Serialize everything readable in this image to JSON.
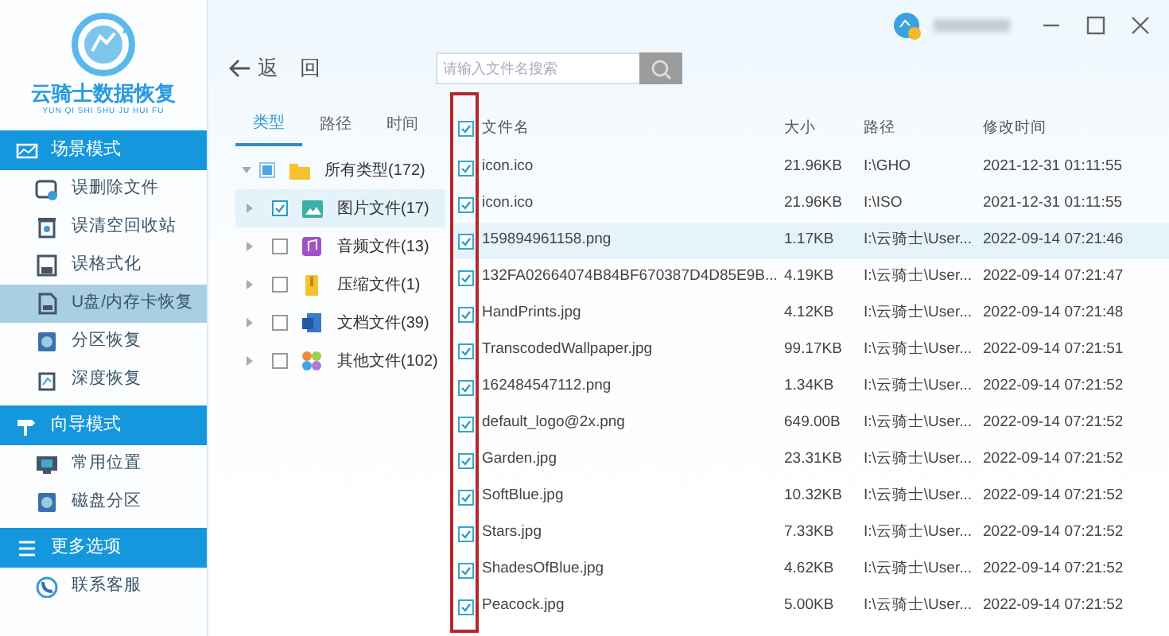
{
  "app": {
    "title": "云骑士数据恢复",
    "subtitle": "YUN QI SHI SHU JU HUI FU"
  },
  "sidebar": {
    "sections": [
      {
        "label": "场景模式",
        "items": [
          {
            "label": "误删除文件",
            "selected": false
          },
          {
            "label": "误清空回收站",
            "selected": false
          },
          {
            "label": "误格式化",
            "selected": false
          },
          {
            "label": "U盘/内存卡恢复",
            "selected": true
          },
          {
            "label": "分区恢复",
            "selected": false
          },
          {
            "label": "深度恢复",
            "selected": false
          }
        ]
      },
      {
        "label": "向导模式",
        "items": [
          {
            "label": "常用位置",
            "selected": false
          },
          {
            "label": "磁盘分区",
            "selected": false
          }
        ]
      },
      {
        "label": "更多选项",
        "items": [
          {
            "label": "联系客服",
            "selected": false
          }
        ]
      }
    ]
  },
  "toolbar": {
    "back": "返 回",
    "search": {
      "placeholder": "请输入文件名搜索"
    }
  },
  "tree": {
    "tabs": [
      {
        "label": "类型",
        "selected": true
      },
      {
        "label": "路径",
        "selected": false
      },
      {
        "label": "时间",
        "selected": false
      }
    ],
    "items": [
      {
        "label": "所有类型(172)",
        "checked": false,
        "partial": true,
        "expanded": true,
        "selected": false,
        "children": [
          {
            "label": "图片文件(17)",
            "checked": true,
            "partial": false,
            "expanded": false,
            "selected": true
          },
          {
            "label": "音频文件(13)",
            "checked": false,
            "partial": false,
            "expanded": false,
            "selected": false
          },
          {
            "label": "压缩文件(1)",
            "checked": false,
            "partial": false,
            "expanded": false,
            "selected": false
          },
          {
            "label": "文档文件(39)",
            "checked": false,
            "partial": false,
            "expanded": false,
            "selected": false
          },
          {
            "label": "其他文件(102)",
            "checked": false,
            "partial": false,
            "expanded": false,
            "selected": false
          }
        ]
      }
    ]
  },
  "table": {
    "all_checked": true,
    "columns": [
      "文件名",
      "大小",
      "路径",
      "修改时间"
    ],
    "rows": [
      {
        "checked": true,
        "selected": false,
        "cells": [
          "icon.ico",
          "21.96KB",
          "I:\\GHO",
          "2021-12-31 01:11:55"
        ]
      },
      {
        "checked": true,
        "selected": false,
        "cells": [
          "icon.ico",
          "21.96KB",
          "I:\\ISO",
          "2021-12-31 01:11:55"
        ]
      },
      {
        "checked": true,
        "selected": true,
        "cells": [
          "159894961158.png",
          "1.17KB",
          "I:\\云骑士\\User...",
          "2022-09-14 07:21:46"
        ]
      },
      {
        "checked": true,
        "selected": false,
        "cells": [
          "132FA02664074B84BF670387D4D85E9B...",
          "4.19KB",
          "I:\\云骑士\\User...",
          "2022-09-14 07:21:47"
        ]
      },
      {
        "checked": true,
        "selected": false,
        "cells": [
          "HandPrints.jpg",
          "4.12KB",
          "I:\\云骑士\\User...",
          "2022-09-14 07:21:48"
        ]
      },
      {
        "checked": true,
        "selected": false,
        "cells": [
          "TranscodedWallpaper.jpg",
          "99.17KB",
          "I:\\云骑士\\User...",
          "2022-09-14 07:21:51"
        ]
      },
      {
        "checked": true,
        "selected": false,
        "cells": [
          "162484547112.png",
          "1.34KB",
          "I:\\云骑士\\User...",
          "2022-09-14 07:21:52"
        ]
      },
      {
        "checked": true,
        "selected": false,
        "cells": [
          "default_logo@2x.png",
          "649.00B",
          "I:\\云骑士\\User...",
          "2022-09-14 07:21:52"
        ]
      },
      {
        "checked": true,
        "selected": false,
        "cells": [
          "Garden.jpg",
          "23.31KB",
          "I:\\云骑士\\User...",
          "2022-09-14 07:21:52"
        ]
      },
      {
        "checked": true,
        "selected": false,
        "cells": [
          "SoftBlue.jpg",
          "10.32KB",
          "I:\\云骑士\\User...",
          "2022-09-14 07:21:52"
        ]
      },
      {
        "checked": true,
        "selected": false,
        "cells": [
          "Stars.jpg",
          "7.33KB",
          "I:\\云骑士\\User...",
          "2022-09-14 07:21:52"
        ]
      },
      {
        "checked": true,
        "selected": false,
        "cells": [
          "ShadesOfBlue.jpg",
          "4.62KB",
          "I:\\云骑士\\User...",
          "2022-09-14 07:21:52"
        ]
      },
      {
        "checked": true,
        "selected": false,
        "cells": [
          "Peacock.jpg",
          "5.00KB",
          "I:\\云骑士\\User...",
          "2022-09-14 07:21:52"
        ]
      }
    ]
  }
}
